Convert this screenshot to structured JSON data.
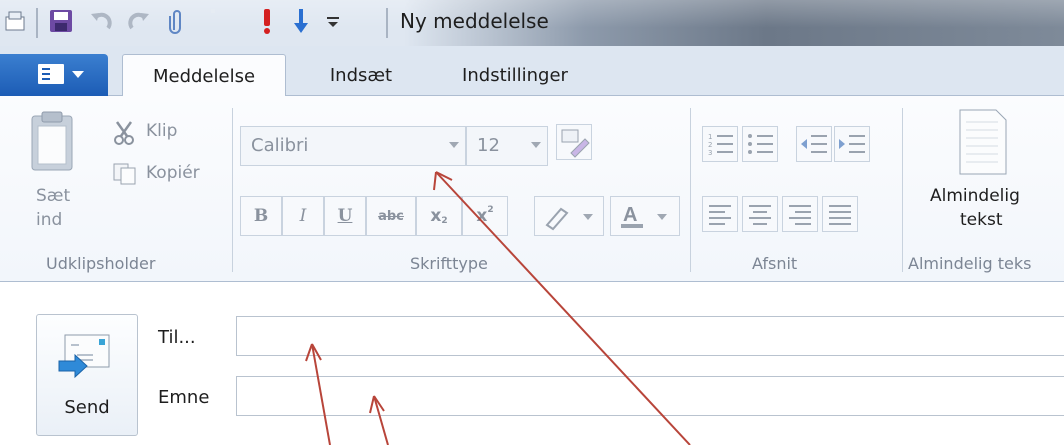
{
  "window": {
    "title": "Ny meddelelse"
  },
  "tabs": [
    {
      "label": "Meddelelse"
    },
    {
      "label": "Indsæt"
    },
    {
      "label": "Indstillinger"
    }
  ],
  "clipboard": {
    "paste_label_line1": "Sæt",
    "paste_label_line2": "ind",
    "cut_label": "Klip",
    "copy_label": "Kopiér",
    "group_label": "Udklipsholder"
  },
  "font": {
    "font_name": "Calibri",
    "font_size": "12",
    "group_label": "Skrifttype"
  },
  "paragraph": {
    "group_label": "Afsnit"
  },
  "plaintext": {
    "button_line1": "Almindelig",
    "button_line2": "tekst",
    "group_label": "Almindelig teks"
  },
  "compose": {
    "send_label": "Send",
    "to_label": "Til...",
    "to_value": "",
    "subject_label": "Emne",
    "subject_value": ""
  },
  "colors": {
    "annotation_arrow": "#b8453a",
    "app_button": "#1c5cb5",
    "important_mark": "#d42020"
  }
}
